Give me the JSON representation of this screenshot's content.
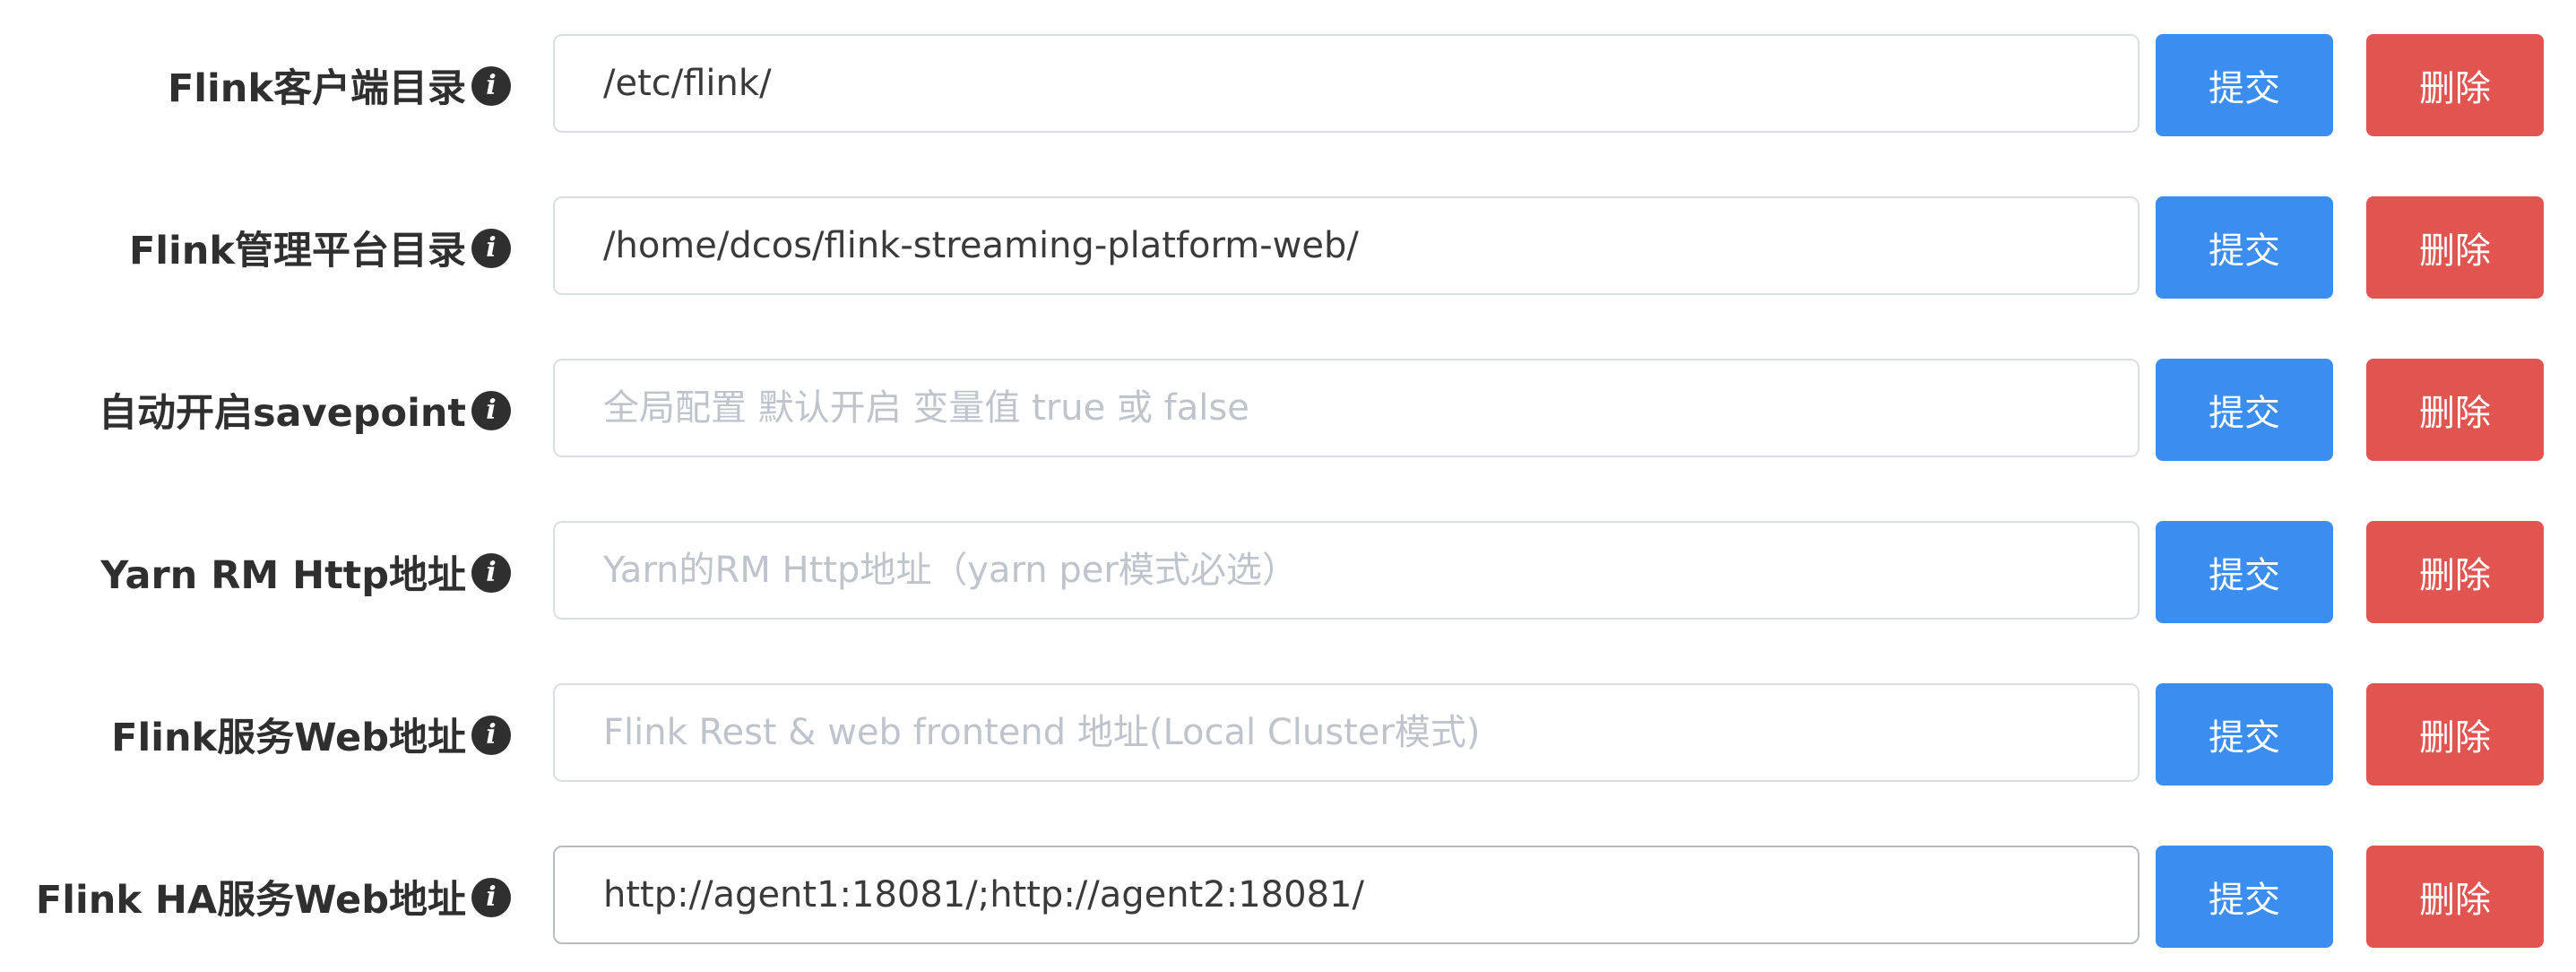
{
  "colors": {
    "submit_button": "#3b8ef0",
    "delete_button": "#e25450",
    "label_text": "#2f2f2f",
    "placeholder_text": "#bfc4cc"
  },
  "rows": [
    {
      "label": "Flink客户端目录",
      "value": "/etc/flink/",
      "placeholder": "",
      "info_icon": "info-icon",
      "submit_label": "提交",
      "delete_label": "删除"
    },
    {
      "label": "Flink管理平台目录",
      "value": "/home/dcos/flink-streaming-platform-web/",
      "placeholder": "",
      "info_icon": "info-icon",
      "submit_label": "提交",
      "delete_label": "删除"
    },
    {
      "label": "自动开启savepoint",
      "value": "",
      "placeholder": "全局配置 默认开启 变量值 true 或 false",
      "info_icon": "info-icon",
      "submit_label": "提交",
      "delete_label": "删除"
    },
    {
      "label": "Yarn RM Http地址",
      "value": "",
      "placeholder": "Yarn的RM Http地址（yarn per模式必选）",
      "info_icon": "info-icon",
      "submit_label": "提交",
      "delete_label": "删除"
    },
    {
      "label": "Flink服务Web地址",
      "value": "",
      "placeholder": "Flink Rest & web frontend 地址(Local Cluster模式)",
      "info_icon": "info-icon",
      "submit_label": "提交",
      "delete_label": "删除"
    },
    {
      "label": "Flink HA服务Web地址",
      "value": "http://agent1:18081/;http://agent2:18081/",
      "placeholder": "",
      "info_icon": "info-icon",
      "submit_label": "提交",
      "delete_label": "删除"
    }
  ]
}
